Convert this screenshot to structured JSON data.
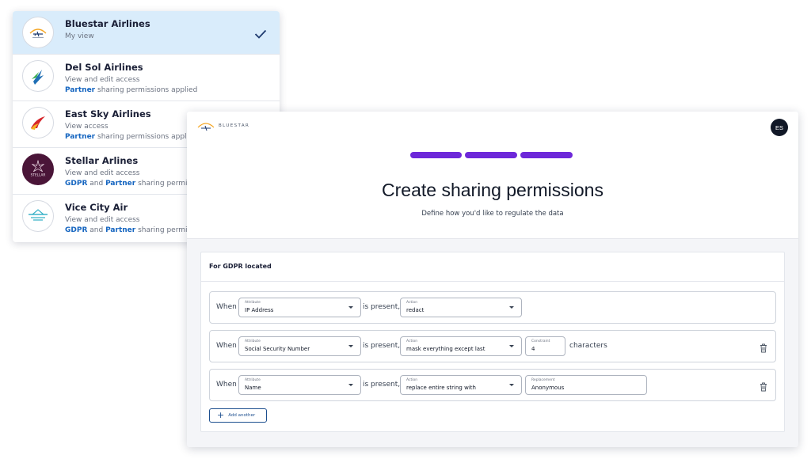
{
  "orgs": [
    {
      "name": "Bluestar Airlines",
      "sub": "My view",
      "selected": true,
      "logo": "bluestar-plane-logo"
    },
    {
      "name": "Del Sol Airlines",
      "sub": "View and edit access",
      "perm_tags": [
        "Partner"
      ],
      "perm_text": "Partner sharing permissions applied",
      "logo": "delsol-wing-logo"
    },
    {
      "name": "East Sky Airlines",
      "sub": "View access",
      "perm_tags": [
        "Partner"
      ],
      "perm_text": "Partner sharing permissions applied",
      "logo": "eastsky-swoosh-logo"
    },
    {
      "name": "Stellar Arlines",
      "sub": "View and edit access",
      "perm_tags": [
        "GDPR",
        "Partner"
      ],
      "perm_text": "GDPR and Partner sharing permissions applied",
      "logo": "stellar-logo",
      "logo_text": "STELLAR"
    },
    {
      "name": "Vice City Air",
      "sub": "View and edit access",
      "perm_tags": [
        "GDPR",
        "Partner"
      ],
      "perm_text": "GDPR and Partner sharing permissions applied",
      "logo": "vicecity-logo"
    }
  ],
  "perm_words": {
    "and": "and",
    "partner_applied_1": "sharing permissions applied",
    "partner_applied_2": "sharing permissions applie",
    "gdpr_applied": "sharing permis"
  },
  "header": {
    "brand": "BLUESTAR",
    "avatar_initials": "ES"
  },
  "wizard": {
    "total_steps": 3,
    "completed_steps": 3,
    "step_color": "#6d28d9"
  },
  "page": {
    "title": "Create sharing permissions",
    "subtitle": "Define how you'd like to regulate the data"
  },
  "card": {
    "header": "For GDPR located",
    "rules": [
      {
        "when": "When",
        "attribute_label": "Attribute",
        "attribute": "IP Address",
        "present": "is present,",
        "action_label": "Action",
        "action": "redact"
      },
      {
        "when": "When",
        "attribute_label": "Attribute",
        "attribute": "Social Security Number",
        "present": "is present,",
        "action_label": "Action",
        "action": "mask everything except last",
        "extra_label": "Constraint",
        "extra": "4",
        "suffix": "characters"
      },
      {
        "when": "When",
        "attribute_label": "Attribute",
        "attribute": "Name",
        "present": "is present,",
        "action_label": "Action",
        "action": "replace entire string with",
        "extra_label": "Replacement",
        "extra": "Anonymous"
      }
    ],
    "add_label": "Add another"
  },
  "colors": {
    "accent": "#6d28d9",
    "link": "#1565c0",
    "selected_bg": "#d9ecfb"
  }
}
